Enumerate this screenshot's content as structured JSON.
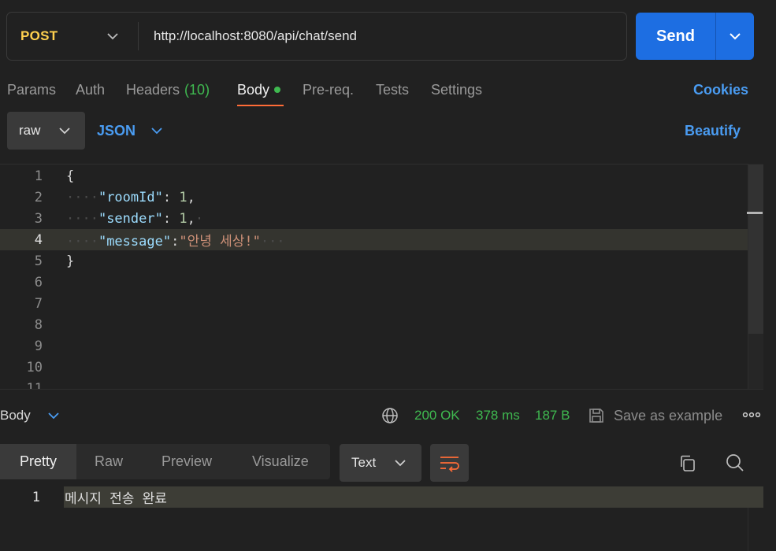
{
  "request": {
    "method": "POST",
    "url": "http://localhost:8080/api/chat/send",
    "send_label": "Send"
  },
  "tabs": {
    "params": "Params",
    "auth": "Auth",
    "headers": "Headers",
    "headers_count": "(10)",
    "body": "Body",
    "prereq": "Pre-req.",
    "tests": "Tests",
    "settings": "Settings",
    "cookies": "Cookies"
  },
  "body_options": {
    "mode": "raw",
    "language": "JSON",
    "beautify": "Beautify"
  },
  "editor": {
    "line_numbers": [
      "1",
      "2",
      "3",
      "4",
      "5",
      "6",
      "7",
      "8",
      "9",
      "10",
      "11"
    ],
    "lines": {
      "l1": "{",
      "l2_key": "\"roomId\"",
      "l2_sep": ": ",
      "l2_val": "1",
      "l2_end": ",",
      "l3_key": "\"sender\"",
      "l3_sep": ": ",
      "l3_val": "1",
      "l3_end": ",",
      "l4_key": "\"message\"",
      "l4_sep": ":",
      "l4_val": "\"안녕 세상!\"",
      "l5": "}"
    },
    "active_line": 4
  },
  "response": {
    "section_label": "Body",
    "status": "200 OK",
    "time": "378 ms",
    "size": "187 B",
    "save_label": "Save as example",
    "view_tabs": [
      "Pretty",
      "Raw",
      "Preview",
      "Visualize"
    ],
    "format": "Text",
    "line_number": "1",
    "content": "메시지 전송 완료"
  },
  "colors": {
    "accent_blue": "#1d6ee2",
    "link_blue": "#4a9cf2",
    "method_yellow": "#ffd14f",
    "status_green": "#3fb950",
    "tab_underline": "#ff6c37"
  },
  "icons": {
    "method_dropdown": "chevron-down-icon",
    "send_dropdown": "chevron-down-icon",
    "network": "globe-icon",
    "save": "save-icon",
    "more": "more-horizontal-icon",
    "wrap": "wrap-lines-icon",
    "copy": "copy-icon",
    "search": "search-icon"
  }
}
